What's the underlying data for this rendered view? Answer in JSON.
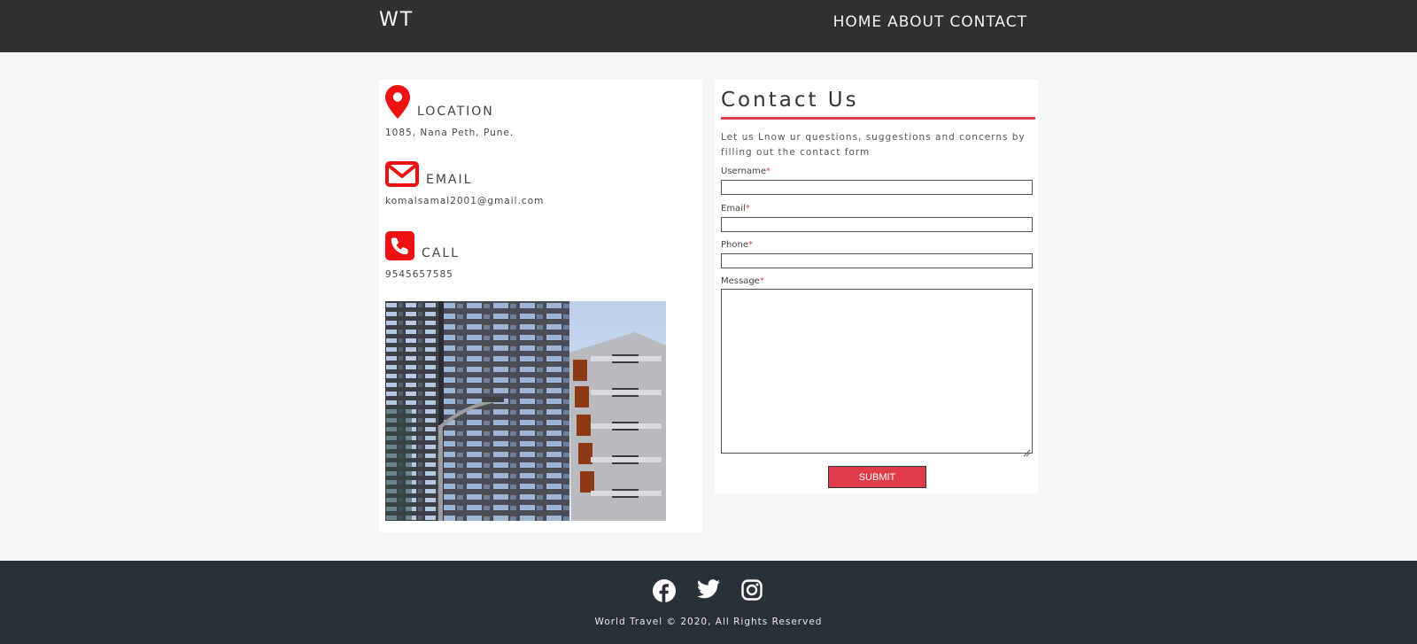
{
  "header": {
    "brand": "WT",
    "nav": [
      "HOME",
      "ABOUT",
      "CONTACT"
    ]
  },
  "info": {
    "location": {
      "title": "LOCATION",
      "text": "1085, Nana Peth, Pune.",
      "icon": "map-pin-icon"
    },
    "email": {
      "title": "EMAIL",
      "text": "komalsamal2001@gmail.com",
      "icon": "envelope-icon"
    },
    "call": {
      "title": "CALL",
      "text": "9545657585",
      "icon": "phone-icon"
    },
    "icon_color": "#ee1111"
  },
  "contact": {
    "title": "Contact Us",
    "description": "Let us Lnow ur questions, suggestions and concerns by filling out the contact form",
    "fields": {
      "username": "Username",
      "email": "Email",
      "phone": "Phone",
      "message": "Message"
    },
    "required_mark": "*",
    "submit": "SUBMIT",
    "accent": "#e0414f"
  },
  "footer": {
    "social": [
      "facebook-icon",
      "twitter-icon",
      "instagram-icon"
    ],
    "copyright": "World Travel © 2020, All Rights Reserved"
  }
}
